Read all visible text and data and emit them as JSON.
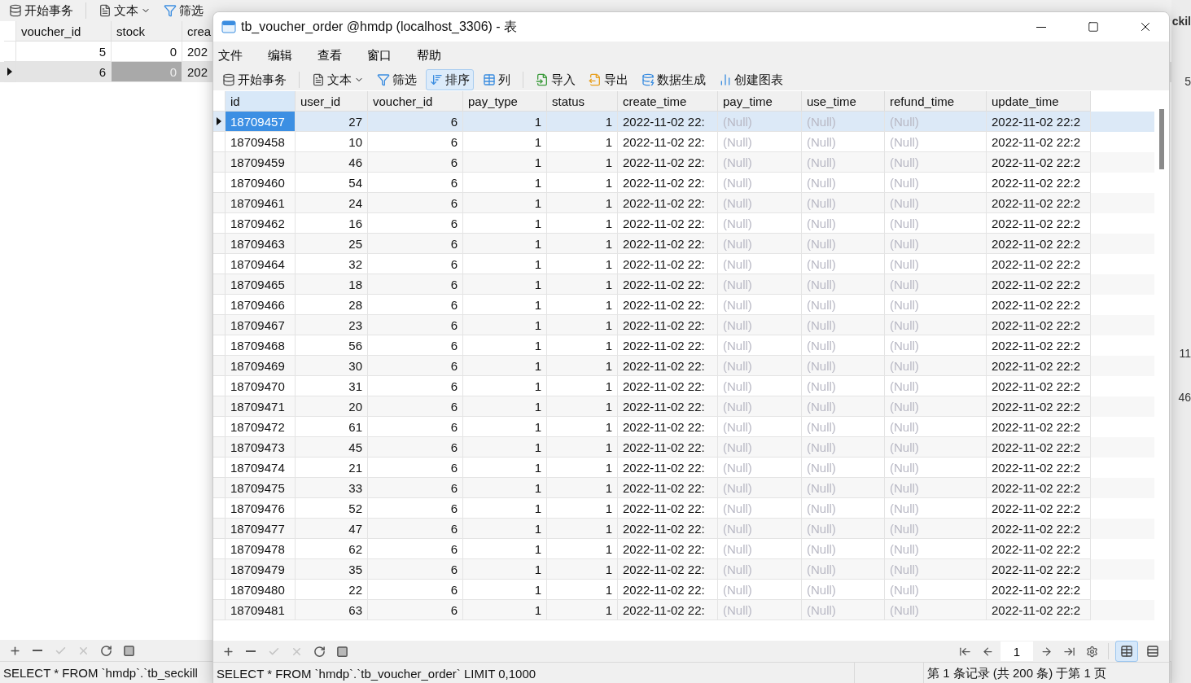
{
  "background": {
    "toolbar": [
      {
        "label": "开始事务",
        "kind": "begin",
        "active": false
      },
      {
        "label": "文本",
        "kind": "text",
        "active": false
      },
      {
        "label": "筛选",
        "kind": "filter",
        "active": false
      }
    ],
    "columns": [
      {
        "label": "voucher_id",
        "kind": "number"
      },
      {
        "label": "stock",
        "kind": "number"
      },
      {
        "label": "crea",
        "kind": "text"
      }
    ],
    "rows": [
      {
        "cells": [
          "5",
          "0",
          "202"
        ],
        "selected": false
      },
      {
        "cells": [
          "6",
          "0",
          "202"
        ],
        "selected": true
      }
    ],
    "actions": [
      {
        "kind": "add",
        "disabled": false
      },
      {
        "kind": "remove",
        "disabled": false
      },
      {
        "kind": "apply",
        "disabled": true
      },
      {
        "kind": "cancel",
        "disabled": true
      },
      {
        "kind": "refresh",
        "disabled": false
      },
      {
        "kind": "stop",
        "disabled": false
      }
    ],
    "sql": "SELECT * FROM `hmdp`.`tb_seckill",
    "side_texts": [
      "ckil",
      "5",
      "11",
      "46"
    ]
  },
  "window": {
    "title": "tb_voucher_order @hmdp (localhost_3306) - 表",
    "menu": [
      "文件",
      "编辑",
      "查看",
      "窗口",
      "帮助"
    ],
    "toolbar": [
      {
        "label": "开始事务",
        "kind": "begin",
        "active": false
      },
      {
        "label": "文本",
        "kind": "text",
        "active": false
      },
      {
        "label": "筛选",
        "kind": "filter",
        "active": false
      },
      {
        "label": "排序",
        "kind": "sort",
        "active": true
      },
      {
        "label": "列",
        "kind": "columns",
        "active": false
      },
      {
        "label": "导入",
        "kind": "import",
        "active": false
      },
      {
        "label": "导出",
        "kind": "export",
        "active": false
      },
      {
        "label": "数据生成",
        "kind": "generate",
        "active": false
      },
      {
        "label": "创建图表",
        "kind": "chart",
        "active": false
      }
    ],
    "columns": [
      {
        "label": "id",
        "kind": "id"
      },
      {
        "label": "user_id",
        "kind": "number"
      },
      {
        "label": "voucher_id",
        "kind": "number"
      },
      {
        "label": "pay_type",
        "kind": "number"
      },
      {
        "label": "status",
        "kind": "number"
      },
      {
        "label": "create_time",
        "kind": "text"
      },
      {
        "label": "pay_time",
        "kind": "null"
      },
      {
        "label": "use_time",
        "kind": "null"
      },
      {
        "label": "refund_time",
        "kind": "null"
      },
      {
        "label": "update_time",
        "kind": "text"
      }
    ],
    "rows": [
      {
        "cells": [
          "18709457",
          "27",
          "6",
          "1",
          "1",
          "2022-11-02 22:",
          "(Null)",
          "(Null)",
          "(Null)",
          "2022-11-02 22:2"
        ],
        "selected": true
      },
      {
        "cells": [
          "18709458",
          "10",
          "6",
          "1",
          "1",
          "2022-11-02 22:",
          "(Null)",
          "(Null)",
          "(Null)",
          "2022-11-02 22:2"
        ],
        "selected": false
      },
      {
        "cells": [
          "18709459",
          "46",
          "6",
          "1",
          "1",
          "2022-11-02 22:",
          "(Null)",
          "(Null)",
          "(Null)",
          "2022-11-02 22:2"
        ],
        "selected": false
      },
      {
        "cells": [
          "18709460",
          "54",
          "6",
          "1",
          "1",
          "2022-11-02 22:",
          "(Null)",
          "(Null)",
          "(Null)",
          "2022-11-02 22:2"
        ],
        "selected": false
      },
      {
        "cells": [
          "18709461",
          "24",
          "6",
          "1",
          "1",
          "2022-11-02 22:",
          "(Null)",
          "(Null)",
          "(Null)",
          "2022-11-02 22:2"
        ],
        "selected": false
      },
      {
        "cells": [
          "18709462",
          "16",
          "6",
          "1",
          "1",
          "2022-11-02 22:",
          "(Null)",
          "(Null)",
          "(Null)",
          "2022-11-02 22:2"
        ],
        "selected": false
      },
      {
        "cells": [
          "18709463",
          "25",
          "6",
          "1",
          "1",
          "2022-11-02 22:",
          "(Null)",
          "(Null)",
          "(Null)",
          "2022-11-02 22:2"
        ],
        "selected": false
      },
      {
        "cells": [
          "18709464",
          "32",
          "6",
          "1",
          "1",
          "2022-11-02 22:",
          "(Null)",
          "(Null)",
          "(Null)",
          "2022-11-02 22:2"
        ],
        "selected": false
      },
      {
        "cells": [
          "18709465",
          "18",
          "6",
          "1",
          "1",
          "2022-11-02 22:",
          "(Null)",
          "(Null)",
          "(Null)",
          "2022-11-02 22:2"
        ],
        "selected": false
      },
      {
        "cells": [
          "18709466",
          "28",
          "6",
          "1",
          "1",
          "2022-11-02 22:",
          "(Null)",
          "(Null)",
          "(Null)",
          "2022-11-02 22:2"
        ],
        "selected": false
      },
      {
        "cells": [
          "18709467",
          "23",
          "6",
          "1",
          "1",
          "2022-11-02 22:",
          "(Null)",
          "(Null)",
          "(Null)",
          "2022-11-02 22:2"
        ],
        "selected": false
      },
      {
        "cells": [
          "18709468",
          "56",
          "6",
          "1",
          "1",
          "2022-11-02 22:",
          "(Null)",
          "(Null)",
          "(Null)",
          "2022-11-02 22:2"
        ],
        "selected": false
      },
      {
        "cells": [
          "18709469",
          "30",
          "6",
          "1",
          "1",
          "2022-11-02 22:",
          "(Null)",
          "(Null)",
          "(Null)",
          "2022-11-02 22:2"
        ],
        "selected": false
      },
      {
        "cells": [
          "18709470",
          "31",
          "6",
          "1",
          "1",
          "2022-11-02 22:",
          "(Null)",
          "(Null)",
          "(Null)",
          "2022-11-02 22:2"
        ],
        "selected": false
      },
      {
        "cells": [
          "18709471",
          "20",
          "6",
          "1",
          "1",
          "2022-11-02 22:",
          "(Null)",
          "(Null)",
          "(Null)",
          "2022-11-02 22:2"
        ],
        "selected": false
      },
      {
        "cells": [
          "18709472",
          "61",
          "6",
          "1",
          "1",
          "2022-11-02 22:",
          "(Null)",
          "(Null)",
          "(Null)",
          "2022-11-02 22:2"
        ],
        "selected": false
      },
      {
        "cells": [
          "18709473",
          "45",
          "6",
          "1",
          "1",
          "2022-11-02 22:",
          "(Null)",
          "(Null)",
          "(Null)",
          "2022-11-02 22:2"
        ],
        "selected": false
      },
      {
        "cells": [
          "18709474",
          "21",
          "6",
          "1",
          "1",
          "2022-11-02 22:",
          "(Null)",
          "(Null)",
          "(Null)",
          "2022-11-02 22:2"
        ],
        "selected": false
      },
      {
        "cells": [
          "18709475",
          "33",
          "6",
          "1",
          "1",
          "2022-11-02 22:",
          "(Null)",
          "(Null)",
          "(Null)",
          "2022-11-02 22:2"
        ],
        "selected": false
      },
      {
        "cells": [
          "18709476",
          "52",
          "6",
          "1",
          "1",
          "2022-11-02 22:",
          "(Null)",
          "(Null)",
          "(Null)",
          "2022-11-02 22:2"
        ],
        "selected": false
      },
      {
        "cells": [
          "18709477",
          "47",
          "6",
          "1",
          "1",
          "2022-11-02 22:",
          "(Null)",
          "(Null)",
          "(Null)",
          "2022-11-02 22:2"
        ],
        "selected": false
      },
      {
        "cells": [
          "18709478",
          "62",
          "6",
          "1",
          "1",
          "2022-11-02 22:",
          "(Null)",
          "(Null)",
          "(Null)",
          "2022-11-02 22:2"
        ],
        "selected": false
      },
      {
        "cells": [
          "18709479",
          "35",
          "6",
          "1",
          "1",
          "2022-11-02 22:",
          "(Null)",
          "(Null)",
          "(Null)",
          "2022-11-02 22:2"
        ],
        "selected": false
      },
      {
        "cells": [
          "18709480",
          "22",
          "6",
          "1",
          "1",
          "2022-11-02 22:",
          "(Null)",
          "(Null)",
          "(Null)",
          "2022-11-02 22:2"
        ],
        "selected": false
      },
      {
        "cells": [
          "18709481",
          "63",
          "6",
          "1",
          "1",
          "2022-11-02 22:",
          "(Null)",
          "(Null)",
          "(Null)",
          "2022-11-02 22:2"
        ],
        "selected": false
      }
    ],
    "actions": [
      {
        "kind": "add",
        "disabled": false
      },
      {
        "kind": "remove",
        "disabled": false
      },
      {
        "kind": "apply",
        "disabled": true
      },
      {
        "kind": "cancel",
        "disabled": true
      },
      {
        "kind": "refresh",
        "disabled": false
      },
      {
        "kind": "stop",
        "disabled": false
      }
    ],
    "page": "1",
    "views": [
      {
        "kind": "grid",
        "selected": true
      },
      {
        "kind": "form",
        "selected": false
      }
    ],
    "sql": "SELECT * FROM `hmdp`.`tb_voucher_order` LIMIT 0,1000",
    "record_info": "第 1 条记录 (共 200 条) 于第 1 页"
  }
}
